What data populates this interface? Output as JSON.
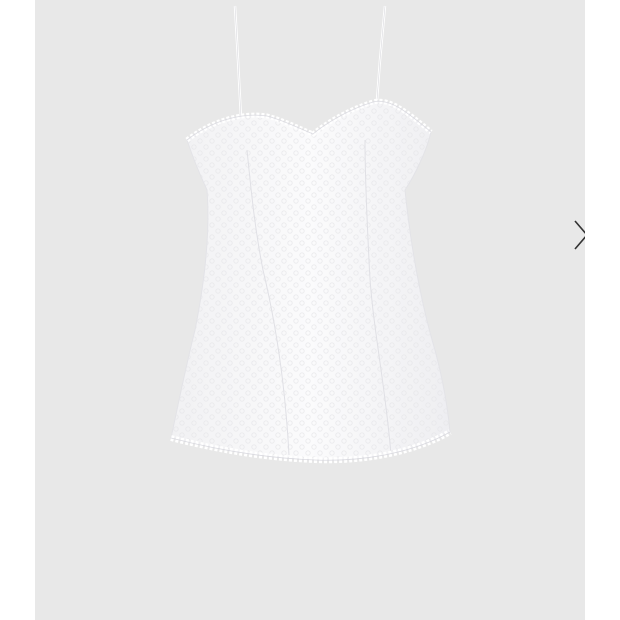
{
  "gallery": {
    "background_color": "#e8e8e8",
    "image": {
      "icon": "white-lace-slip-dress"
    },
    "next_button": {
      "icon": "chevron-right-icon"
    }
  }
}
